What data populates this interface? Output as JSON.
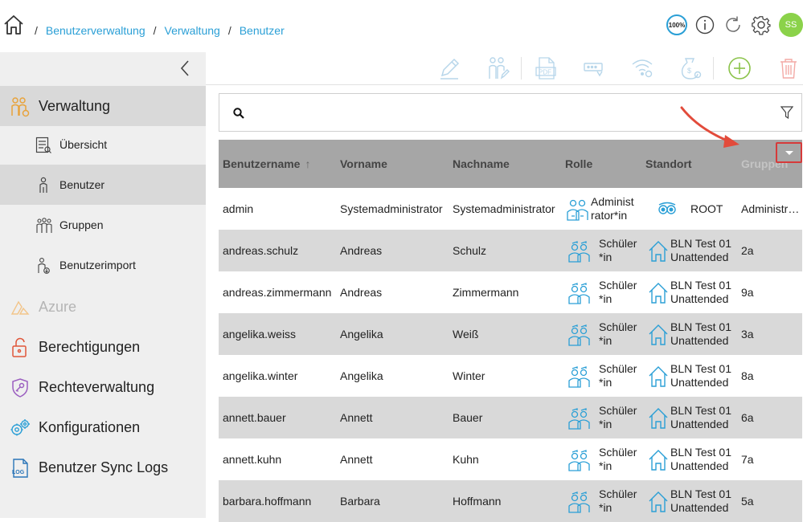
{
  "breadcrumb": {
    "separator": "/",
    "items": [
      "Benutzerverwaltung",
      "Verwaltung",
      "Benutzer"
    ]
  },
  "header": {
    "zoom_label": "100%",
    "avatar_initials": "SS"
  },
  "sidebar": {
    "main_section": "Verwaltung",
    "sub_items": [
      {
        "label": "Übersicht",
        "icon": "overview-icon"
      },
      {
        "label": "Benutzer",
        "icon": "user-icon"
      },
      {
        "label": "Gruppen",
        "icon": "group-icon"
      },
      {
        "label": "Benutzerimport",
        "icon": "user-import-icon"
      }
    ],
    "sections": [
      {
        "label": "Azure",
        "icon": "azure-icon"
      },
      {
        "label": "Berechtigungen",
        "icon": "lock-icon"
      },
      {
        "label": "Rechteverwaltung",
        "icon": "shield-key-icon"
      },
      {
        "label": "Konfigurationen",
        "icon": "gears-icon"
      },
      {
        "label": "Benutzer Sync Logs",
        "icon": "log-icon"
      }
    ]
  },
  "search": {
    "placeholder": ""
  },
  "table": {
    "columns": [
      "Benutzername",
      "Vorname",
      "Nachname",
      "Rolle",
      "Standort",
      "Gruppen"
    ],
    "rows": [
      {
        "username": "admin",
        "first": "Systemadministrator",
        "last": "Systemadministrator",
        "role1": "Administ",
        "role2": "rator*in",
        "loc1": "ROOT",
        "loc2": "",
        "group": "Administratoren"
      },
      {
        "username": "andreas.schulz",
        "first": "Andreas",
        "last": "Schulz",
        "role1": "Schüler",
        "role2": "*in",
        "loc1": "BLN Test 01",
        "loc2": "Unattended",
        "group": "2a"
      },
      {
        "username": "andreas.zimmermann",
        "first": "Andreas",
        "last": "Zimmermann",
        "role1": "Schüler",
        "role2": "*in",
        "loc1": "BLN Test 01",
        "loc2": "Unattended",
        "group": "9a"
      },
      {
        "username": "angelika.weiss",
        "first": "Angelika",
        "last": "Weiß",
        "role1": "Schüler",
        "role2": "*in",
        "loc1": "BLN Test 01",
        "loc2": "Unattended",
        "group": "3a"
      },
      {
        "username": "angelika.winter",
        "first": "Angelika",
        "last": "Winter",
        "role1": "Schüler",
        "role2": "*in",
        "loc1": "BLN Test 01",
        "loc2": "Unattended",
        "group": "8a"
      },
      {
        "username": "annett.bauer",
        "first": "Annett",
        "last": "Bauer",
        "role1": "Schüler",
        "role2": "*in",
        "loc1": "BLN Test 01",
        "loc2": "Unattended",
        "group": "6a"
      },
      {
        "username": "annett.kuhn",
        "first": "Annett",
        "last": "Kuhn",
        "role1": "Schüler",
        "role2": "*in",
        "loc1": "BLN Test 01",
        "loc2": "Unattended",
        "group": "7a"
      },
      {
        "username": "barbara.hoffmann",
        "first": "Barbara",
        "last": "Hoffmann",
        "role1": "Schüler",
        "role2": "*in",
        "loc1": "BLN Test 01",
        "loc2": "Unattended",
        "group": "5a"
      }
    ]
  },
  "colors": {
    "accent": "#2a9fd6",
    "avatar": "#8bd24a",
    "header_row": "#a6a6a6",
    "alt_row": "#d9d9d9",
    "highlight": "#d63a3a"
  }
}
